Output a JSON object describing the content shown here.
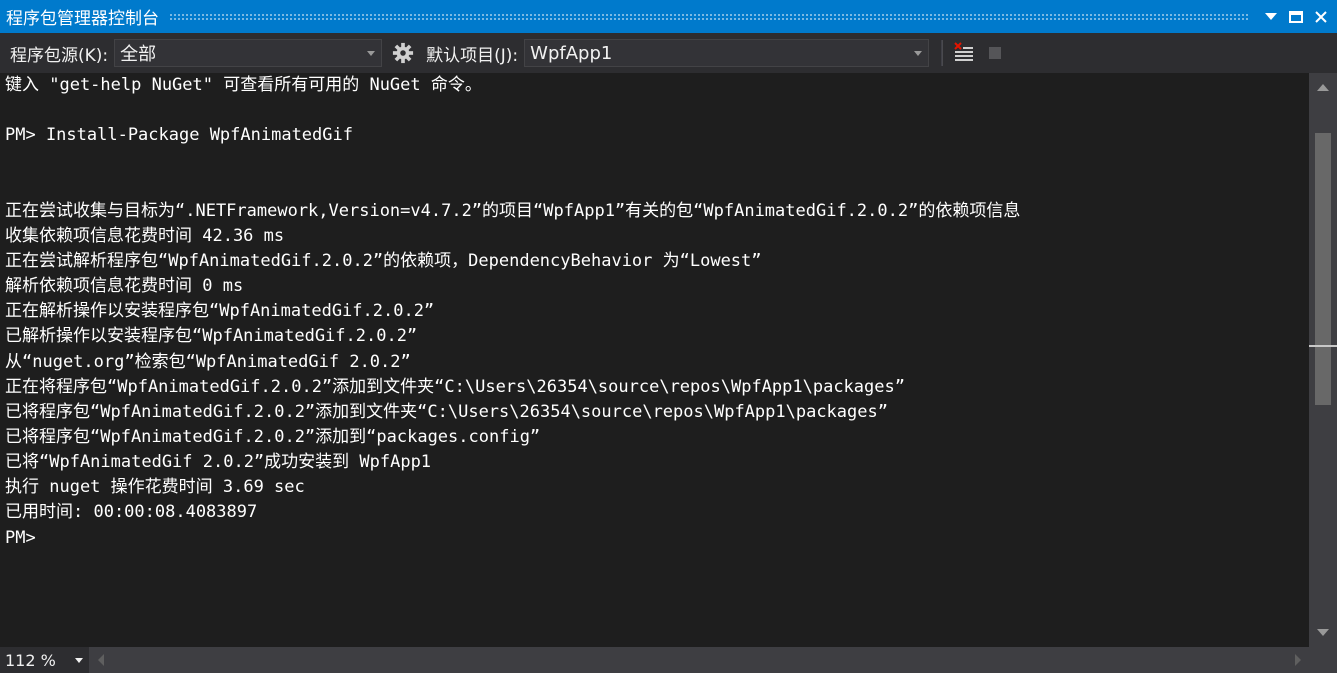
{
  "window": {
    "title": "程序包管理器控制台",
    "icons": [
      "chevron-down-icon",
      "maximize-icon",
      "close-icon"
    ]
  },
  "toolbar": {
    "source_label": "程序包源(K):",
    "source_value": "全部",
    "settings_icon": "gear-icon",
    "project_label": "默认项目(J):",
    "project_value": "WpfApp1",
    "clear_icon": "clear-console-icon",
    "stop_icon": "stop-icon"
  },
  "console": {
    "lines": [
      "键入 \"get-help NuGet\" 可查看所有可用的 NuGet 命令。",
      "",
      "PM> Install-Package WpfAnimatedGif",
      "",
      "",
      "正在尝试收集与目标为“.NETFramework,Version=v4.7.2”的项目“WpfApp1”有关的包“WpfAnimatedGif.2.0.2”的依赖项信息",
      "收集依赖项信息花费时间 42.36 ms",
      "正在尝试解析程序包“WpfAnimatedGif.2.0.2”的依赖项，DependencyBehavior 为“Lowest”",
      "解析依赖项信息花费时间 0 ms",
      "正在解析操作以安装程序包“WpfAnimatedGif.2.0.2”",
      "已解析操作以安装程序包“WpfAnimatedGif.2.0.2”",
      "从“nuget.org”检索包“WpfAnimatedGif 2.0.2”",
      "正在将程序包“WpfAnimatedGif.2.0.2”添加到文件夹“C:\\Users\\26354\\source\\repos\\WpfApp1\\packages”",
      "已将程序包“WpfAnimatedGif.2.0.2”添加到文件夹“C:\\Users\\26354\\source\\repos\\WpfApp1\\packages”",
      "已将程序包“WpfAnimatedGif.2.0.2”添加到“packages.config”",
      "已将“WpfAnimatedGif 2.0.2”成功安装到 WpfApp1",
      "执行 nuget 操作花费时间 3.69 sec",
      "已用时间: 00:00:08.4083897",
      "PM>"
    ]
  },
  "status": {
    "zoom": "112 %"
  },
  "colors": {
    "title_bar": "#007acc",
    "toolbar": "#2d2d30",
    "console_bg": "#1e1e1e",
    "console_text": "#ffffff",
    "scrollbar": "#3e3e42"
  }
}
